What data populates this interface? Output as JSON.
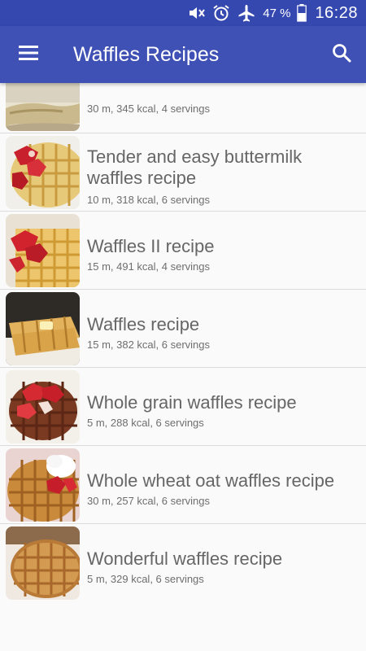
{
  "status_bar": {
    "battery": "47 %",
    "time": "16:28",
    "icons": [
      "mute-icon",
      "alarm-icon",
      "airplane-mode-icon",
      "battery-icon"
    ]
  },
  "app_bar": {
    "title": "Waffles Recipes",
    "menu_icon": "hamburger-menu-icon",
    "search_icon": "search-icon"
  },
  "recipes": [
    {
      "title": "",
      "meta": "30 m, 345 kcal, 4 servings"
    },
    {
      "title": "Tender and easy buttermilk waffles recipe",
      "meta": "10 m, 318 kcal, 6 servings"
    },
    {
      "title": "Waffles II recipe",
      "meta": "15 m, 491 kcal, 4 servings"
    },
    {
      "title": "Waffles recipe",
      "meta": "15 m, 382 kcal, 6 servings"
    },
    {
      "title": "Whole grain waffles recipe",
      "meta": "5 m, 288 kcal, 6 servings"
    },
    {
      "title": "Whole wheat oat waffles recipe",
      "meta": "30 m, 257 kcal, 6 servings"
    },
    {
      "title": "Wonderful waffles recipe",
      "meta": "5 m, 329 kcal, 6 servings"
    }
  ],
  "colors": {
    "primary": "#3f51b5",
    "status_bar": "#3548b0",
    "title_text": "#666666",
    "meta_text": "#6e6e6e"
  }
}
